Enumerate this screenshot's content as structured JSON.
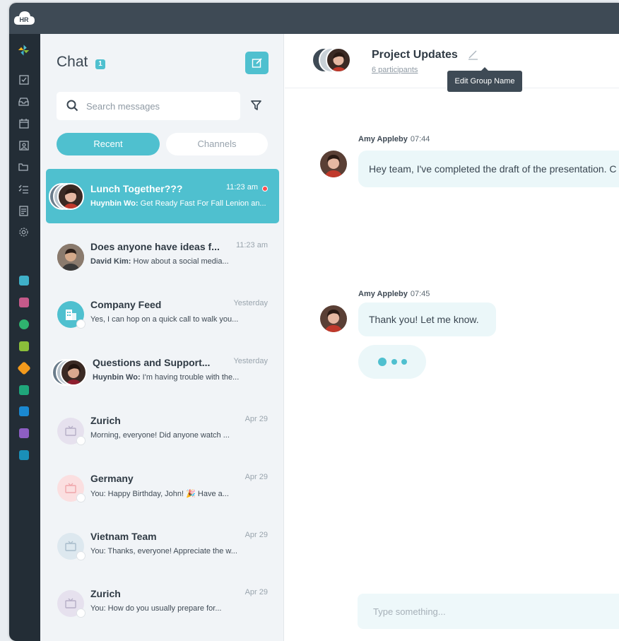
{
  "brand": {
    "logo_text": "HR"
  },
  "rail": {
    "icons": [
      "pinwheel-icon",
      "checkbox-icon",
      "inbox-icon",
      "calendar-icon",
      "contact-icon",
      "folder-icon",
      "checklist-icon",
      "document-icon",
      "gear-icon"
    ],
    "apps": [
      {
        "name": "team-app-icon",
        "color": "#3fb0c8"
      },
      {
        "name": "badge-app-icon",
        "color": "#c55a8a"
      },
      {
        "name": "award-app-icon",
        "color": "#2fb36f"
      },
      {
        "name": "travel-app-icon",
        "color": "#8bbf3a"
      },
      {
        "name": "star-app-icon",
        "color": "#f39a1c"
      },
      {
        "name": "money-app-icon",
        "color": "#1fa67a"
      },
      {
        "name": "search-app-icon",
        "color": "#1a88d0"
      },
      {
        "name": "file-app-icon",
        "color": "#8d5ec3"
      },
      {
        "name": "excel-app-icon",
        "color": "#1a8fb8"
      }
    ]
  },
  "chatlist": {
    "title": "Chat",
    "count": "1",
    "search_placeholder": "Search messages",
    "tabs": {
      "recent": "Recent",
      "channels": "Channels"
    },
    "conversations": [
      {
        "name": "Lunch Together???",
        "sender": "Huynbin Wo:",
        "preview": " Get Ready Fast For Fall Lenion an...",
        "time": "11:23 am",
        "active": true,
        "unread": true
      },
      {
        "name": "Does anyone have ideas f...",
        "sender": "David Kim:",
        "preview": " How about a social media...",
        "time": "11:23 am"
      },
      {
        "name": "Company Feed",
        "sender": "",
        "preview": "Yes, I can hop on a quick call to walk you...",
        "time": "Yesterday"
      },
      {
        "name": "Questions and Support...",
        "sender": "Huynbin Wo:",
        "preview": " I'm having trouble with the...",
        "time": "Yesterday"
      },
      {
        "name": "Zurich",
        "sender": "",
        "preview": "Morning, everyone! Did anyone watch ...",
        "time": "Apr 29"
      },
      {
        "name": "Germany",
        "sender": "",
        "preview": "You: Happy Birthday, John! 🎉 Have a...",
        "time": "Apr 29"
      },
      {
        "name": "Vietnam Team",
        "sender": "",
        "preview": "You: Thanks, everyone! Appreciate the w...",
        "time": "Apr 29"
      },
      {
        "name": "Zurich",
        "sender": "",
        "preview": "You:  How do you usually prepare for...",
        "time": "Apr 29"
      }
    ]
  },
  "main": {
    "group_name": "Project Updates",
    "participants": "6 participants",
    "tooltip": "Edit Group Name",
    "messages": [
      {
        "author": "Amy Appleby",
        "time": "07:44",
        "text": "Hey team, I've completed the draft of the presentation. C"
      },
      {
        "author": "Amy Appleby",
        "time": "07:45",
        "text": "Thank you! Let me know."
      }
    ],
    "composer_placeholder": "Type something..."
  },
  "colors": {
    "accent": "#4fc0cf",
    "topbar": "#3e4a55",
    "rail": "#232d36",
    "unread": "#ff4d4f"
  }
}
